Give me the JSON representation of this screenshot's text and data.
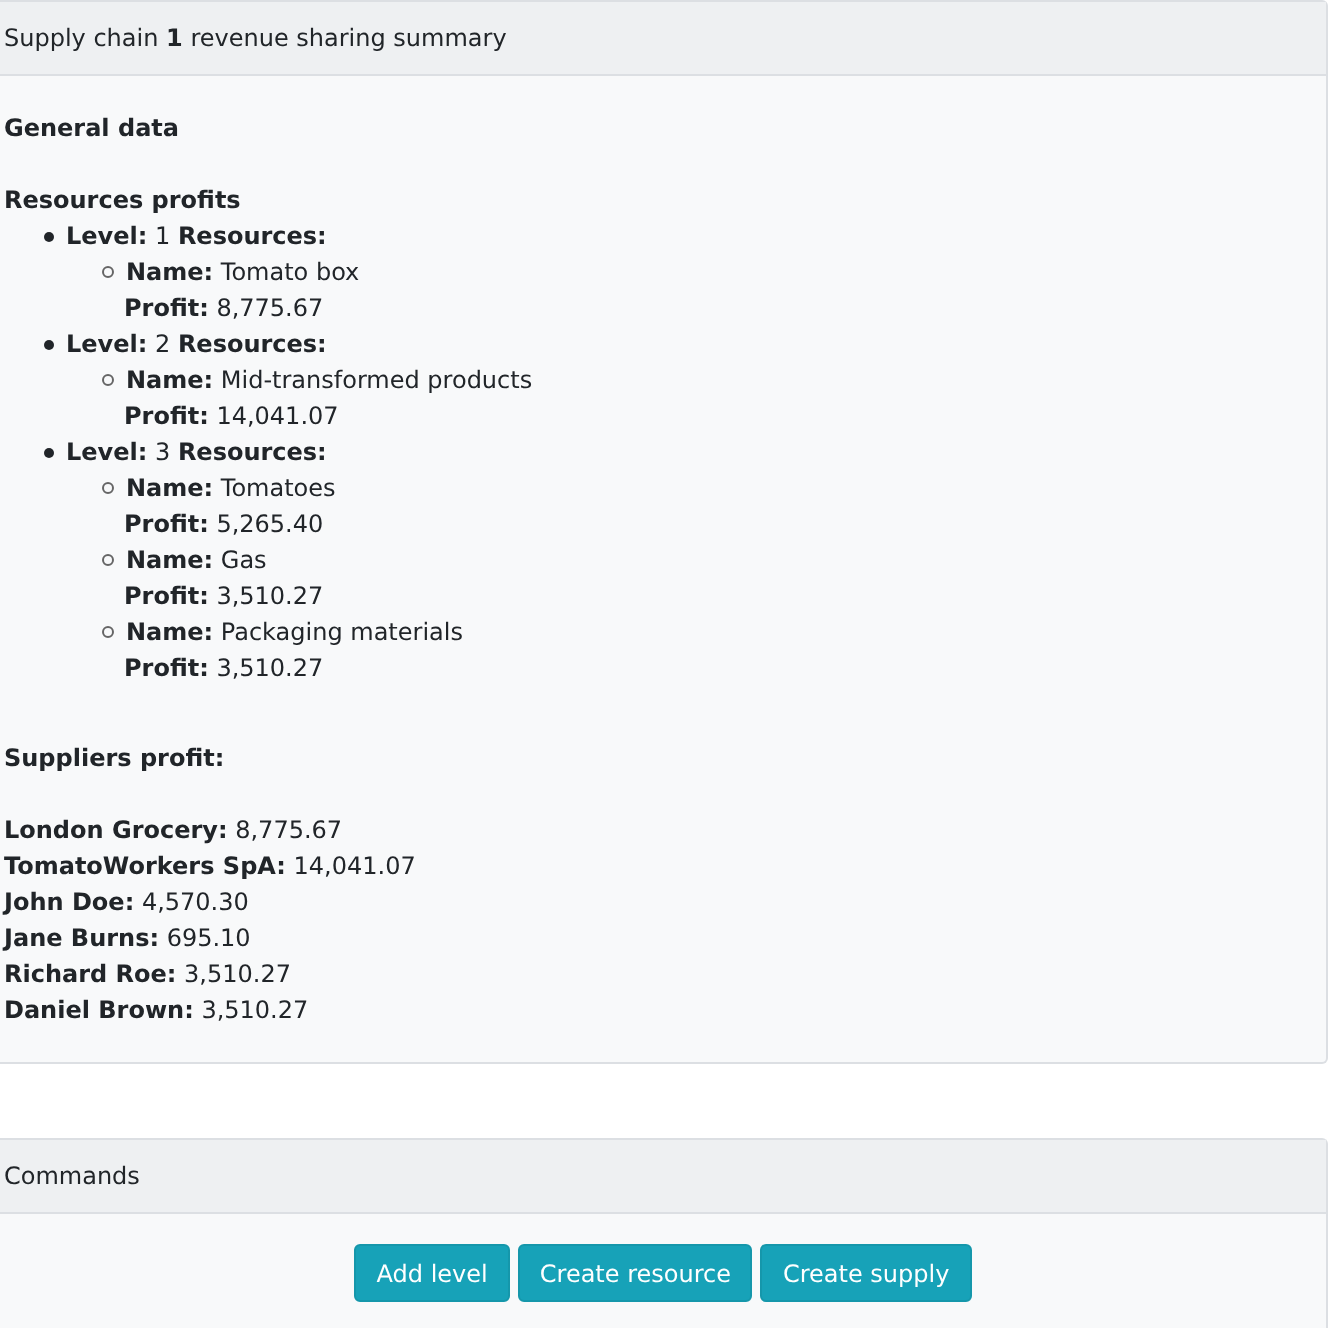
{
  "summary_card": {
    "title": "Supply chain **1** revenue sharing summary",
    "general_heading": "General data",
    "resources_heading": "Resources profits",
    "levels": [
      {
        "label": "**Level:** 1 **Resources:**",
        "resources": [
          {
            "name": "**Name:** Tomato box",
            "profit": "**Profit:** 8,775.67"
          }
        ]
      },
      {
        "label": "**Level:** 2 **Resources:**",
        "resources": [
          {
            "name": "**Name:** Mid-transformed products",
            "profit": "**Profit:** 14,041.07"
          }
        ]
      },
      {
        "label": "**Level:** 3 **Resources:**",
        "resources": [
          {
            "name": "**Name:** Tomatoes",
            "profit": "**Profit:** 5,265.40"
          },
          {
            "name": "**Name:** Gas",
            "profit": "**Profit:** 3,510.27"
          },
          {
            "name": "**Name:** Packaging materials",
            "profit": "**Profit:** 3,510.27"
          }
        ]
      }
    ],
    "suppliers_heading": "Suppliers profit:",
    "suppliers": [
      "**London Grocery:** 8,775.67",
      "**TomatoWorkers SpA:** 14,041.07",
      "**John Doe:** 4,570.30",
      "**Jane Burns:** 695.10",
      "**Richard Roe:** 3,510.27",
      "**Daniel Brown:** 3,510.27"
    ]
  },
  "commands_card": {
    "title": "Commands",
    "buttons": [
      "Add level",
      "Create resource",
      "Create supply"
    ]
  }
}
